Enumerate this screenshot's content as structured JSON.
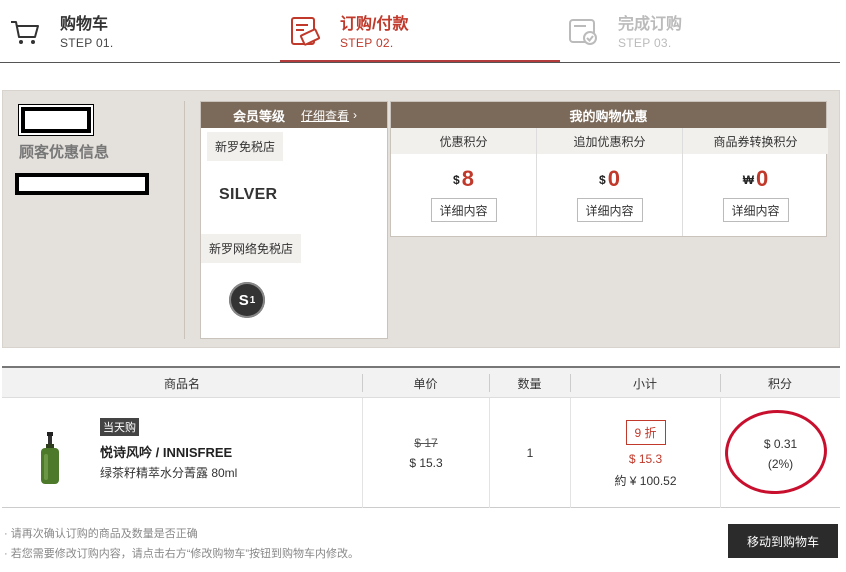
{
  "steps": [
    {
      "title": "购物车",
      "sub": "STEP 01."
    },
    {
      "title": "订购/付款",
      "sub": "STEP 02."
    },
    {
      "title": "完成订购",
      "sub": "STEP 03."
    }
  ],
  "customer": {
    "label": "顾客优惠信息"
  },
  "member": {
    "head_title": "会员等级",
    "head_link": "仔细查看",
    "store1": "新罗免税店",
    "level1": "SILVER",
    "store2": "新罗网络免税店",
    "level2_main": "S",
    "level2_sub": "1"
  },
  "benefit": {
    "head": "我的购物优惠",
    "cols": [
      {
        "title": "优惠积分",
        "currency": "$",
        "value": "8",
        "button": "详细内容"
      },
      {
        "title": "追加优惠积分",
        "currency": "$",
        "value": "0",
        "button": "详细内容"
      },
      {
        "title": "商品券转换积分",
        "currency": "₩",
        "value": "0",
        "button": "详细内容"
      }
    ]
  },
  "table": {
    "headers": [
      "商品名",
      "单价",
      "数量",
      "小计",
      "积分"
    ],
    "row": {
      "tag": "当天购",
      "name": "悦诗风吟 / INNISFREE",
      "desc": "绿茶籽精萃水分菁露 80ml",
      "price_old": "$ 17",
      "price_new": "$ 15.3",
      "qty": "1",
      "discount": "9 折",
      "subtotal_usd": "$ 15.3",
      "subtotal_cny": "約 ¥ 100.52",
      "points": "$ 0.31",
      "points_pct": "(2%)"
    }
  },
  "notes": [
    "· 请再次确认订购的商品及数量是否正确",
    "· 若您需要修改订购内容，请点击右方“修改购物车”按钮到购物车内修改。"
  ],
  "move_button": "移动到购物车",
  "colors": {
    "accent": "#c0392b",
    "header_brown": "#7b6a5a",
    "panel_bg": "#e4e0db",
    "circle": "#c8102e"
  },
  "icons": {
    "step1": "cart-icon",
    "step2": "order-card-icon",
    "step3": "order-complete-icon",
    "head_link": "chevron-right-icon"
  }
}
